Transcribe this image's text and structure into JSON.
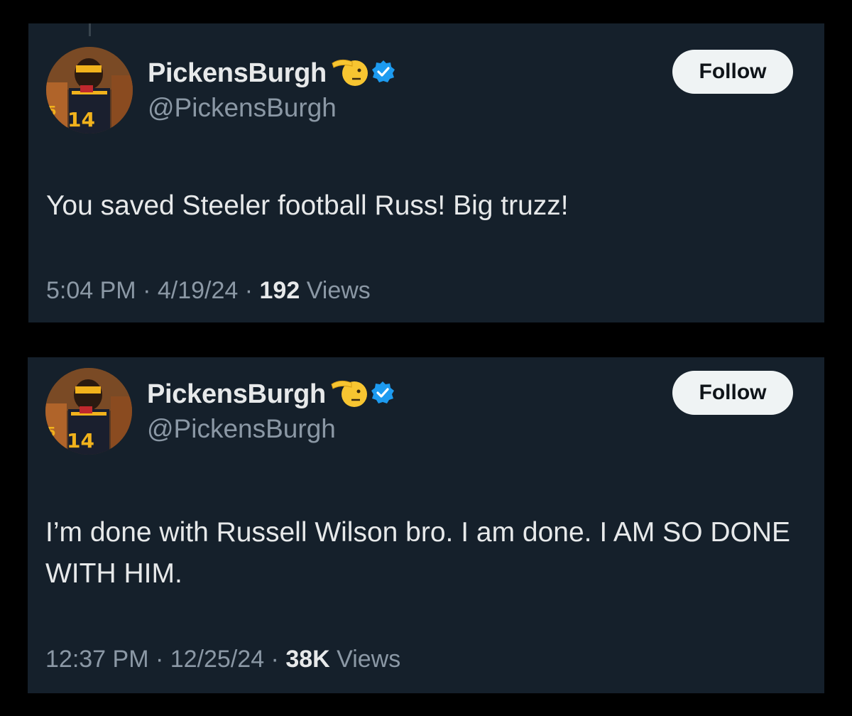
{
  "tweets": [
    {
      "display_name": "PickensBurgh",
      "handle": "@PickensBurgh",
      "follow_label": "Follow",
      "text": "You saved Steeler football Russ! Big truzz!",
      "time": "5:04 PM",
      "separator": " · ",
      "date": "4/19/24",
      "views_count": "192",
      "views_label": " Views"
    },
    {
      "display_name": "PickensBurgh",
      "handle": "@PickensBurgh",
      "follow_label": "Follow",
      "text": "I’m done with Russell Wilson bro. I am done. I AM SO DONE WITH HIM.",
      "time": "12:37 PM",
      "separator": " · ",
      "date": "12/25/24",
      "views_count": "38K",
      "views_label": " Views"
    }
  ],
  "colors": {
    "page_background": "#000000",
    "card_background": "#15202b",
    "primary_text": "#e7e9ea",
    "secondary_text": "#8b98a5",
    "verified_blue": "#1d9bf0",
    "follow_button_bg": "#eff3f4"
  },
  "icons": [
    "saluting-face-icon",
    "verified-badge-icon"
  ]
}
